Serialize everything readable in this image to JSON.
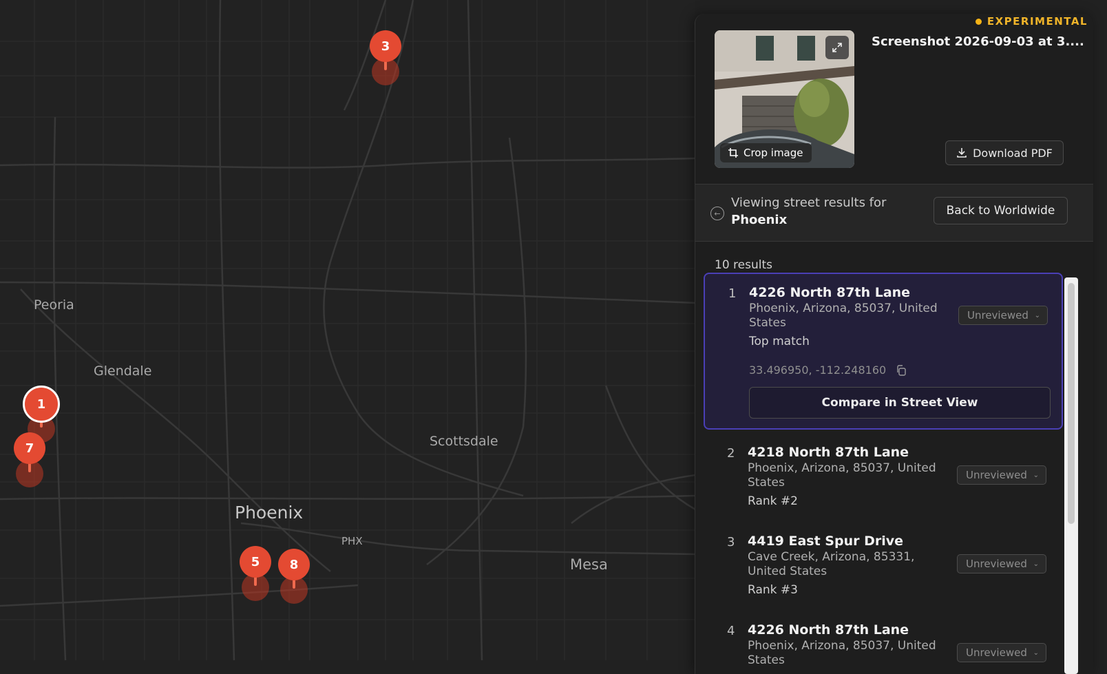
{
  "map": {
    "cities": [
      {
        "id": "peoria",
        "label": "Peoria"
      },
      {
        "id": "glendale",
        "label": "Glendale"
      },
      {
        "id": "scottsdale",
        "label": "Scottsdale"
      },
      {
        "id": "phoenix",
        "label": "Phoenix"
      },
      {
        "id": "phx",
        "label": "PHX"
      },
      {
        "id": "mesa",
        "label": "Mesa"
      }
    ],
    "pins": [
      {
        "label": "3"
      },
      {
        "label": "1",
        "selected": true
      },
      {
        "label": "7"
      },
      {
        "label": "5"
      },
      {
        "label": "8"
      }
    ],
    "colors": {
      "pin": "#e44a32",
      "background": "#212121",
      "roads": "#3a3a3a"
    }
  },
  "panel": {
    "badge": "EXPERIMENTAL",
    "file_title": "Screenshot 2026-09-03 at 3....",
    "crop_label": "Crop image",
    "download_label": "Download PDF",
    "viewing_prefix": "Viewing street results for",
    "viewing_city": "Phoenix",
    "back_label": "Back to Worldwide",
    "results_count": "10 results",
    "compare_label": "Compare in Street View",
    "results": [
      {
        "num": "1",
        "title": "4226 North 87th Lane",
        "addr": "Phoenix, Arizona, 85037, United States",
        "rank": "Top match",
        "status": "Unreviewed",
        "coords": "33.496950, -112.248160"
      },
      {
        "num": "2",
        "title": "4218 North 87th Lane",
        "addr": "Phoenix, Arizona, 85037, United States",
        "rank": "Rank #2",
        "status": "Unreviewed"
      },
      {
        "num": "3",
        "title": "4419 East Spur Drive",
        "addr": "Cave Creek, Arizona, 85331, United States",
        "rank": "Rank #3",
        "status": "Unreviewed"
      },
      {
        "num": "4",
        "title": "4226 North 87th Lane",
        "addr": "Phoenix, Arizona, 85037, United States",
        "status": "Unreviewed"
      }
    ],
    "colors": {
      "badge": "#f0b429",
      "active_border": "#4a3fb6",
      "active_bg": "#231f3a"
    }
  }
}
